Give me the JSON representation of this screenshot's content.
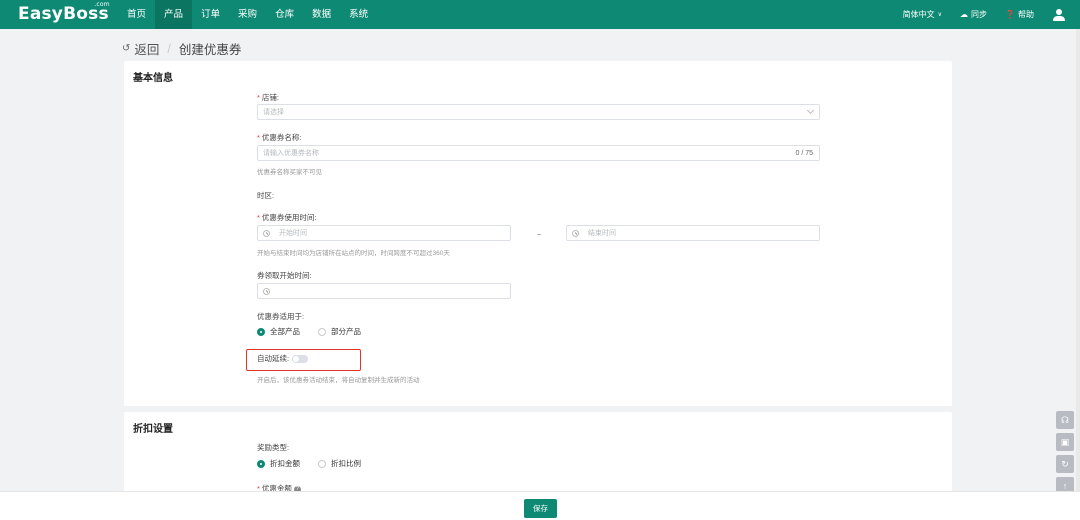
{
  "header": {
    "logo": "EasyBoss",
    "logo_sup": ".com",
    "nav": [
      {
        "label": "首页"
      },
      {
        "label": "产品"
      },
      {
        "label": "订单"
      },
      {
        "label": "采购"
      },
      {
        "label": "仓库"
      },
      {
        "label": "数据"
      },
      {
        "label": "系统"
      }
    ],
    "active_nav": "产品",
    "language": "简体中文",
    "sync": "同步",
    "help": "帮助"
  },
  "breadcrumb": {
    "back": "返回",
    "title": "创建优惠券"
  },
  "basic": {
    "section_title": "基本信息",
    "store_label": "店铺:",
    "store_placeholder": "请选择",
    "name_label": "优惠券名称:",
    "name_placeholder": "请输入优惠券名称",
    "name_count": "0 / 75",
    "name_hint": "优惠券名称买家不可见",
    "timezone_label": "时区:",
    "use_time_label": "优惠券使用时间:",
    "start_placeholder": "开始时间",
    "range_sep": "~",
    "end_placeholder": "结束时间",
    "time_hint": "开始与结束时间均为店铺所在站点的时间，时间跨度不可超过360天",
    "claim_label": "券领取开始时间:",
    "apply_label": "优惠券适用于:",
    "apply_options": [
      {
        "label": "全部产品",
        "selected": true
      },
      {
        "label": "部分产品",
        "selected": false
      }
    ],
    "auto_renew_label": "自动延续:",
    "auto_renew_on": false,
    "auto_renew_hint": "开启后，该优惠券活动结束，将自动复制并生成新的活动"
  },
  "discount": {
    "section_title": "折扣设置",
    "reward_label": "奖励类型:",
    "reward_options": [
      {
        "label": "折扣金额",
        "selected": true
      },
      {
        "label": "折扣比例",
        "selected": false
      }
    ],
    "amount_label": "优惠金额"
  },
  "footer": {
    "save": "保存"
  },
  "colors": {
    "brand": "#0e8a74",
    "highlight": "#e0332c"
  }
}
